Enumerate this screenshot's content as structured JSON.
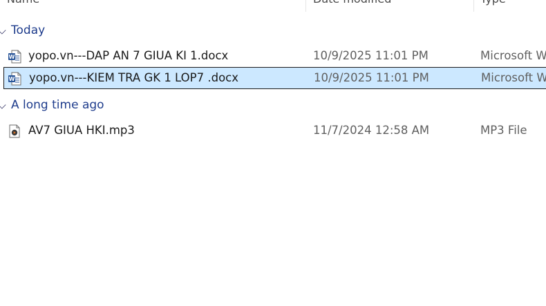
{
  "columns": {
    "name": "Name",
    "date_modified": "Date modified",
    "type": "Type"
  },
  "groups": [
    {
      "label": "Today",
      "items": [
        {
          "name": "yopo.vn---DAP AN 7 GIUA KI 1.docx",
          "date": "10/9/2025 11:01 PM",
          "type": "Microsoft Word Document",
          "icon": "word-document-icon",
          "selected": false
        },
        {
          "name": "yopo.vn---KIEM TRA GK 1  LOP7 .docx",
          "date": "10/9/2025 11:01 PM",
          "type": "Microsoft Word Document",
          "icon": "word-document-icon",
          "selected": true
        }
      ]
    },
    {
      "label": "A long time ago",
      "items": [
        {
          "name": "AV7 GIUA HKI.mp3",
          "date": "11/7/2024 12:58 AM",
          "type": "MP3 File",
          "icon": "mp3-audio-icon",
          "selected": false
        }
      ]
    }
  ],
  "colors": {
    "group_label": "#1e3c8c",
    "selection_bg": "#cce8ff",
    "word_blue": "#2b579a"
  }
}
